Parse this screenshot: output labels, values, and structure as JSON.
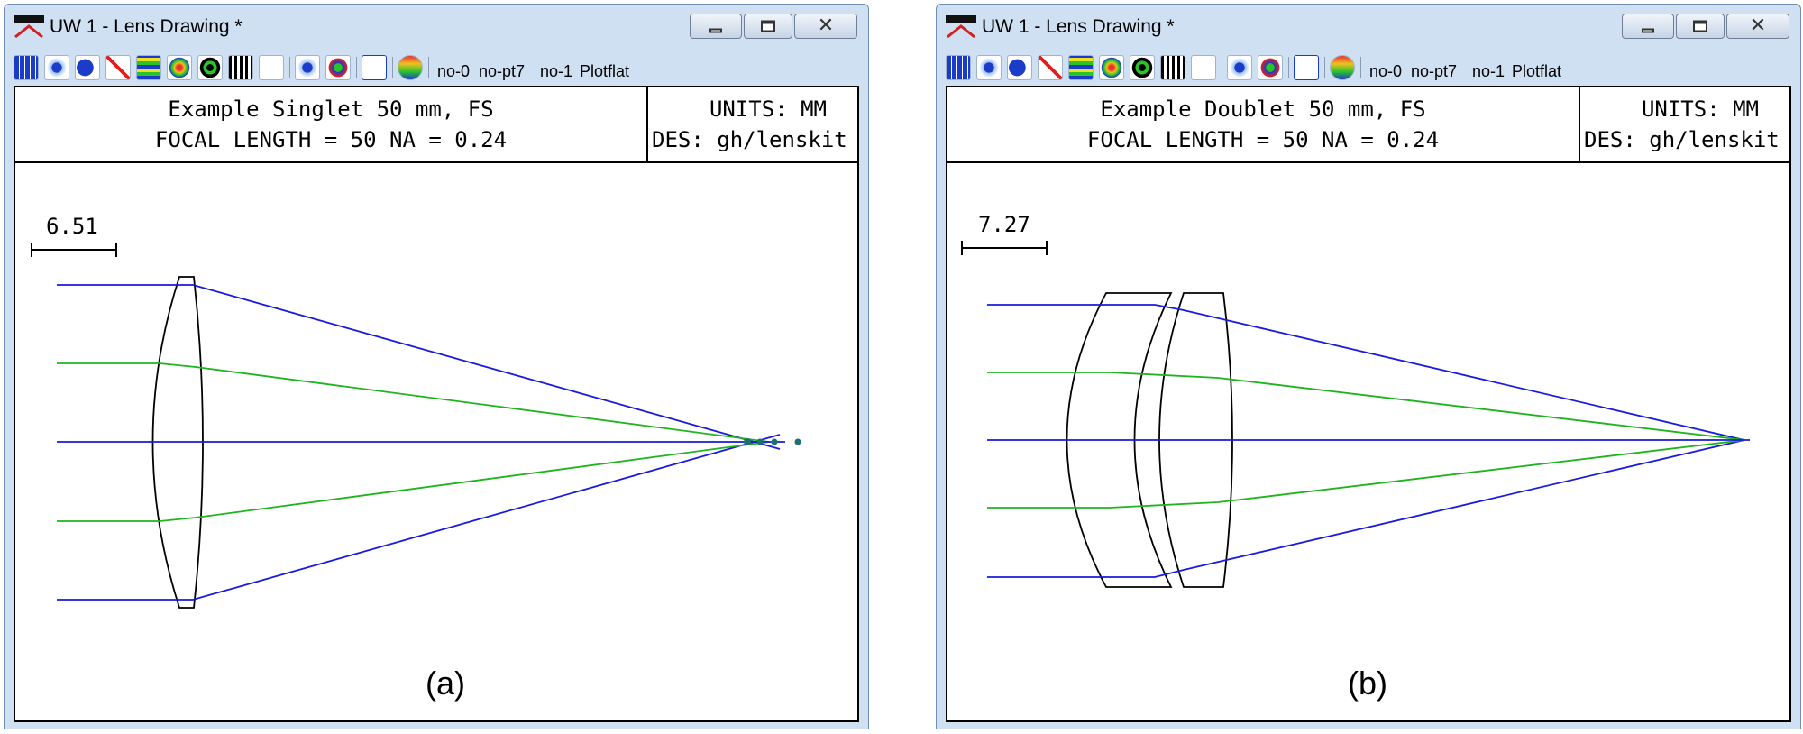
{
  "windows": [
    {
      "id": "a",
      "title": "UW 1 - Lens Drawing *",
      "toolbar_text": [
        "no-0",
        "no-pt7",
        "no-1",
        "Plotflat"
      ],
      "header": {
        "line1": "Example Singlet 50 mm, FS",
        "line2": "FOCAL LENGTH = 50  NA = 0.24",
        "units": "UNITS: MM",
        "designer": "DES: gh/lenskit"
      },
      "scale_bar_label": "6.51",
      "panel_label": "(a)",
      "ray_colors": {
        "marginal": "#1a1adc",
        "zone": "#1eb41e",
        "lens": "#000000"
      }
    },
    {
      "id": "b",
      "title": "UW 1 - Lens Drawing *",
      "toolbar_text": [
        "no-0",
        "no-pt7",
        "no-1",
        "Plotflat"
      ],
      "header": {
        "line1": "Example Doublet 50 mm, FS",
        "line2": "FOCAL LENGTH = 50  NA = 0.24",
        "units": "UNITS: MM",
        "designer": "DES: gh/lenskit"
      },
      "scale_bar_label": "7.27",
      "panel_label": "(b)",
      "ray_colors": {
        "marginal": "#1a1adc",
        "zone": "#1eb41e",
        "lens": "#000000"
      }
    }
  ],
  "toolbar_icons": [
    "grid-icon",
    "lens-layout-icon",
    "spot-blob-icon",
    "ray-fan-icon",
    "wavefront-icon",
    "psf-icon",
    "target-icon",
    "bars-icon",
    "arrows-icon",
    "lens-layout-2-icon",
    "mtf-icon",
    "graph-icon",
    "color-sphere-icon"
  ]
}
